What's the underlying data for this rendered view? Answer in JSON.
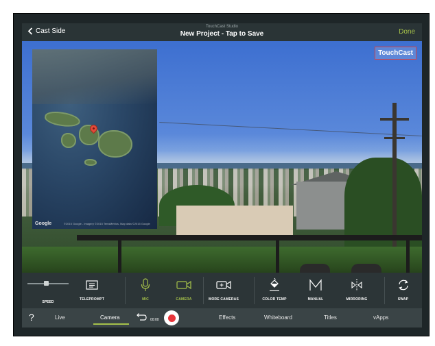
{
  "topbar": {
    "back_label": "Cast Side",
    "studio_label": "TouchCast Studio",
    "title": "New Project - Tap to Save",
    "done_label": "Done"
  },
  "scene": {
    "logo_text": "TouchCast",
    "map": {
      "brand": "Google",
      "attribution": "©2015 Google - Imagery ©2015 TerraMetrics, Map data ©2015 Google"
    }
  },
  "toolbar": {
    "speed": {
      "label": "SPEED",
      "value": 0.45
    },
    "tools": [
      {
        "label": "TELEPROMPT",
        "icon": "teleprompt-icon",
        "active": false
      },
      {
        "label": "MIC",
        "icon": "mic-icon",
        "active": true
      },
      {
        "label": "CAMERA",
        "icon": "camera-icon",
        "active": true
      },
      {
        "label": "MORE CAMERAS",
        "icon": "more-cameras-icon",
        "active": false
      },
      {
        "label": "COLOR TEMP",
        "icon": "color-temp-icon",
        "active": false
      },
      {
        "label": "MANUAL",
        "icon": "manual-icon",
        "active": false
      },
      {
        "label": "MIRRORING",
        "icon": "mirroring-icon",
        "active": false
      },
      {
        "label": "SWAP",
        "icon": "swap-icon",
        "active": false
      }
    ]
  },
  "navbar": {
    "help_label": "?",
    "items": [
      "Live",
      "Camera",
      "Effects",
      "Whiteboard",
      "Titles",
      "vApps"
    ],
    "active": "Camera",
    "record_time": "00:00"
  },
  "colors": {
    "accent": "#a6c24a",
    "record": "#e8353a",
    "toolbar_bg": "#2c3537"
  }
}
